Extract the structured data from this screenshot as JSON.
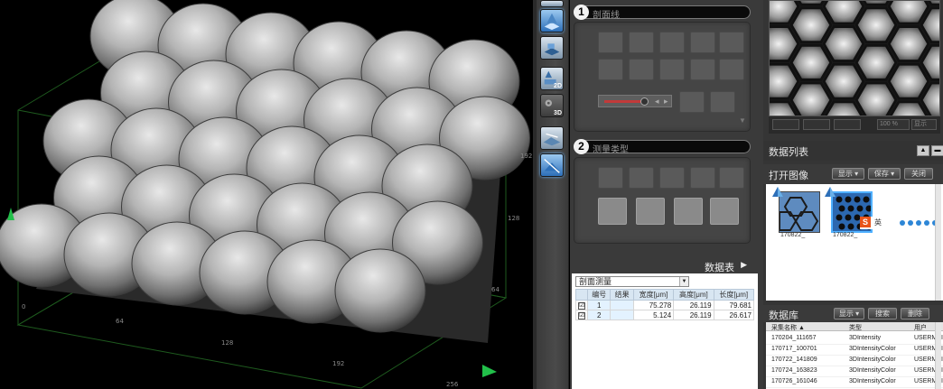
{
  "viewer": {
    "axis_ticks": {
      "bottom": [
        "64",
        "128",
        "192",
        "256"
      ],
      "left": [
        "0"
      ],
      "right": [
        "192",
        "128",
        "64"
      ]
    },
    "colors": {
      "grid": "#1e5a1e",
      "axis_marker": "#22c04a"
    }
  },
  "toolbar": {
    "buttons": [
      {
        "icon": "surface-3d-icon"
      },
      {
        "icon": "surface-fill-icon"
      },
      {
        "icon": "view-2d-icon",
        "mode": "2D"
      },
      {
        "icon": "view-3d-icon",
        "mode": "3D"
      },
      {
        "icon": "measure-tool-icon"
      },
      {
        "icon": "profile-tool-icon"
      }
    ]
  },
  "analysis": {
    "section1": {
      "step": "1",
      "title": "剖面线"
    },
    "section2": {
      "step": "2",
      "title": "测量类型"
    },
    "data_table": {
      "header": "数据表",
      "mode_select": "剖面测量",
      "columns": [
        "编号",
        "结果",
        "宽度[μm]",
        "高度[μm]",
        "长度[μm]"
      ],
      "rows": [
        {
          "id": "1",
          "width": "75.278",
          "height": "26.119",
          "length": "79.681",
          "checked": "☑"
        },
        {
          "id": "2",
          "width": "5.124",
          "height": "26.119",
          "length": "26.617",
          "checked": "☑"
        }
      ]
    }
  },
  "right": {
    "preview_status": [
      "100 %",
      "显示"
    ],
    "data_list": {
      "title": "数据列表"
    },
    "open_images": {
      "title": "打开图像",
      "buttons": [
        "显示 ▾",
        "保存 ▾",
        "关闭"
      ],
      "thumbs": [
        "170822_",
        "170822_"
      ],
      "ime_label": "英"
    },
    "database": {
      "title": "数据库",
      "buttons": [
        "显示 ▾",
        "搜索",
        "删除"
      ],
      "columns": [
        "采集名称 ▲",
        "类型",
        "用户"
      ],
      "rows": [
        {
          "name": "170204_111657",
          "type": "3DIntensity",
          "user": "USERMAI"
        },
        {
          "name": "170717_100701",
          "type": "3DIntensityColor",
          "user": "USERMAI"
        },
        {
          "name": "170722_141809",
          "type": "3DIntensityColor",
          "user": "USERMAI"
        },
        {
          "name": "170724_163823",
          "type": "3DIntensityColor",
          "user": "USERMAI"
        },
        {
          "name": "170726_161046",
          "type": "3DIntensityColor",
          "user": "USERMAI"
        }
      ]
    }
  }
}
